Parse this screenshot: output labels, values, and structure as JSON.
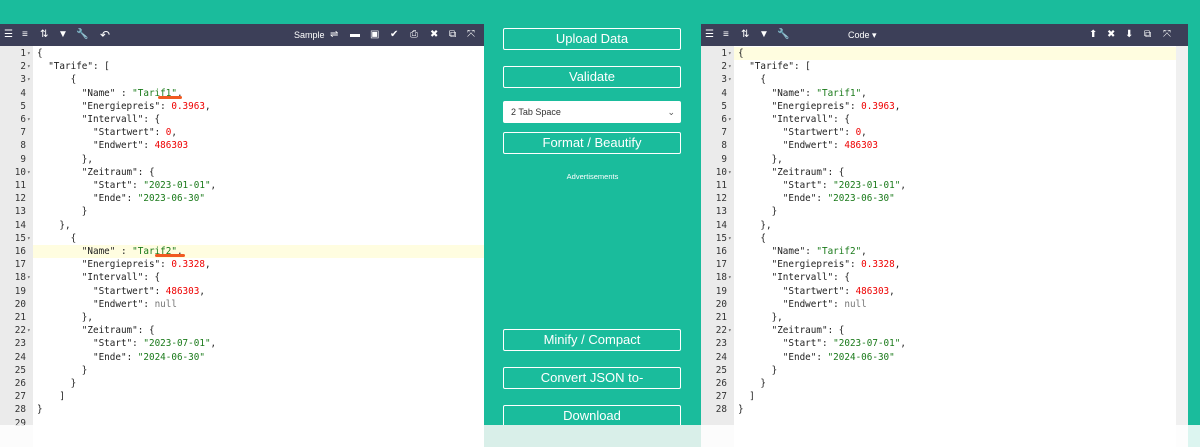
{
  "left_toolbar": {
    "title": "Sample"
  },
  "right_toolbar": {
    "title": "Code ▾"
  },
  "middle": {
    "upload": "Upload Data",
    "validate": "Validate",
    "indent_select": "2 Tab Space",
    "format": "Format / Beautify",
    "ads": "Advertisements",
    "minify": "Minify / Compact",
    "convert": "Convert JSON to-",
    "download": "Download"
  },
  "left_lines": [
    {
      "n": "1",
      "f": "▾",
      "t": [
        [
          "p",
          "{"
        ]
      ]
    },
    {
      "n": "2",
      "f": "▾",
      "t": [
        [
          "p",
          "  "
        ],
        [
          "k",
          "\"Tarife\""
        ],
        [
          "p",
          ": ["
        ]
      ]
    },
    {
      "n": "3",
      "f": "▾",
      "t": [
        [
          "p",
          "      {"
        ]
      ]
    },
    {
      "n": "4",
      "f": "",
      "t": [
        [
          "p",
          "        "
        ],
        [
          "k",
          "\"Name\""
        ],
        [
          "p",
          " : "
        ],
        [
          "s",
          "\"Tarif1\""
        ],
        [
          "p",
          ","
        ]
      ]
    },
    {
      "n": "5",
      "f": "",
      "t": [
        [
          "p",
          "        "
        ],
        [
          "k",
          "\"Energiepreis\""
        ],
        [
          "p",
          ": "
        ],
        [
          "n",
          "0.3963"
        ],
        [
          "p",
          ","
        ]
      ]
    },
    {
      "n": "6",
      "f": "▾",
      "t": [
        [
          "p",
          "        "
        ],
        [
          "k",
          "\"Intervall\""
        ],
        [
          "p",
          ": {"
        ]
      ]
    },
    {
      "n": "7",
      "f": "",
      "t": [
        [
          "p",
          "          "
        ],
        [
          "k",
          "\"Startwert\""
        ],
        [
          "p",
          ": "
        ],
        [
          "n",
          "0"
        ],
        [
          "p",
          ","
        ]
      ]
    },
    {
      "n": "8",
      "f": "",
      "t": [
        [
          "p",
          "          "
        ],
        [
          "k",
          "\"Endwert\""
        ],
        [
          "p",
          ": "
        ],
        [
          "n",
          "486303"
        ]
      ]
    },
    {
      "n": "9",
      "f": "",
      "t": [
        [
          "p",
          "        },"
        ]
      ]
    },
    {
      "n": "10",
      "f": "▾",
      "t": [
        [
          "p",
          "        "
        ],
        [
          "k",
          "\"Zeitraum\""
        ],
        [
          "p",
          ": {"
        ]
      ]
    },
    {
      "n": "11",
      "f": "",
      "t": [
        [
          "p",
          "          "
        ],
        [
          "k",
          "\"Start\""
        ],
        [
          "p",
          ": "
        ],
        [
          "s",
          "\"2023-01-01\""
        ],
        [
          "p",
          ","
        ]
      ]
    },
    {
      "n": "12",
      "f": "",
      "t": [
        [
          "p",
          "          "
        ],
        [
          "k",
          "\"Ende\""
        ],
        [
          "p",
          ": "
        ],
        [
          "s",
          "\"2023-06-30\""
        ]
      ]
    },
    {
      "n": "13",
      "f": "",
      "t": [
        [
          "p",
          "        }"
        ]
      ]
    },
    {
      "n": "14",
      "f": "",
      "t": [
        [
          "p",
          "    },"
        ]
      ]
    },
    {
      "n": "15",
      "f": "▾",
      "t": [
        [
          "p",
          "      {"
        ]
      ]
    },
    {
      "n": "16",
      "f": "",
      "t": [
        [
          "p",
          "        "
        ],
        [
          "k",
          "\"Name\""
        ],
        [
          "p",
          " : "
        ],
        [
          "s",
          "\"Tarif2\""
        ],
        [
          "p",
          ","
        ]
      ]
    },
    {
      "n": "17",
      "f": "",
      "t": [
        [
          "p",
          "        "
        ],
        [
          "k",
          "\"Energiepreis\""
        ],
        [
          "p",
          ": "
        ],
        [
          "n",
          "0.3328"
        ],
        [
          "p",
          ","
        ]
      ]
    },
    {
      "n": "18",
      "f": "▾",
      "t": [
        [
          "p",
          "        "
        ],
        [
          "k",
          "\"Intervall\""
        ],
        [
          "p",
          ": {"
        ]
      ]
    },
    {
      "n": "19",
      "f": "",
      "t": [
        [
          "p",
          "          "
        ],
        [
          "k",
          "\"Startwert\""
        ],
        [
          "p",
          ": "
        ],
        [
          "n",
          "486303"
        ],
        [
          "p",
          ","
        ]
      ]
    },
    {
      "n": "20",
      "f": "",
      "t": [
        [
          "p",
          "          "
        ],
        [
          "k",
          "\"Endwert\""
        ],
        [
          "p",
          ": "
        ],
        [
          "nu",
          "null"
        ]
      ]
    },
    {
      "n": "21",
      "f": "",
      "t": [
        [
          "p",
          "        },"
        ]
      ]
    },
    {
      "n": "22",
      "f": "▾",
      "t": [
        [
          "p",
          "        "
        ],
        [
          "k",
          "\"Zeitraum\""
        ],
        [
          "p",
          ": {"
        ]
      ]
    },
    {
      "n": "23",
      "f": "",
      "t": [
        [
          "p",
          "          "
        ],
        [
          "k",
          "\"Start\""
        ],
        [
          "p",
          ": "
        ],
        [
          "s",
          "\"2023-07-01\""
        ],
        [
          "p",
          ","
        ]
      ]
    },
    {
      "n": "24",
      "f": "",
      "t": [
        [
          "p",
          "          "
        ],
        [
          "k",
          "\"Ende\""
        ],
        [
          "p",
          ": "
        ],
        [
          "s",
          "\"2024-06-30\""
        ]
      ]
    },
    {
      "n": "25",
      "f": "",
      "t": [
        [
          "p",
          "        }"
        ]
      ]
    },
    {
      "n": "26",
      "f": "",
      "t": [
        [
          "p",
          "      }"
        ]
      ]
    },
    {
      "n": "27",
      "f": "",
      "t": [
        [
          "p",
          "    ]"
        ]
      ]
    },
    {
      "n": "28",
      "f": "",
      "t": [
        [
          "p",
          "}"
        ]
      ]
    },
    {
      "n": "29",
      "f": "",
      "t": []
    }
  ],
  "right_lines": [
    {
      "n": "1",
      "f": "▾",
      "t": [
        [
          "p",
          "{"
        ]
      ]
    },
    {
      "n": "2",
      "f": "▾",
      "t": [
        [
          "p",
          "  "
        ],
        [
          "k",
          "\"Tarife\""
        ],
        [
          "p",
          ": ["
        ]
      ]
    },
    {
      "n": "3",
      "f": "▾",
      "t": [
        [
          "p",
          "    {"
        ]
      ]
    },
    {
      "n": "4",
      "f": "",
      "t": [
        [
          "p",
          "      "
        ],
        [
          "k",
          "\"Name\""
        ],
        [
          "p",
          ": "
        ],
        [
          "s",
          "\"Tarif1\""
        ],
        [
          "p",
          ","
        ]
      ]
    },
    {
      "n": "5",
      "f": "",
      "t": [
        [
          "p",
          "      "
        ],
        [
          "k",
          "\"Energiepreis\""
        ],
        [
          "p",
          ": "
        ],
        [
          "n",
          "0.3963"
        ],
        [
          "p",
          ","
        ]
      ]
    },
    {
      "n": "6",
      "f": "▾",
      "t": [
        [
          "p",
          "      "
        ],
        [
          "k",
          "\"Intervall\""
        ],
        [
          "p",
          ": {"
        ]
      ]
    },
    {
      "n": "7",
      "f": "",
      "t": [
        [
          "p",
          "        "
        ],
        [
          "k",
          "\"Startwert\""
        ],
        [
          "p",
          ": "
        ],
        [
          "n",
          "0"
        ],
        [
          "p",
          ","
        ]
      ]
    },
    {
      "n": "8",
      "f": "",
      "t": [
        [
          "p",
          "        "
        ],
        [
          "k",
          "\"Endwert\""
        ],
        [
          "p",
          ": "
        ],
        [
          "n",
          "486303"
        ]
      ]
    },
    {
      "n": "9",
      "f": "",
      "t": [
        [
          "p",
          "      },"
        ]
      ]
    },
    {
      "n": "10",
      "f": "▾",
      "t": [
        [
          "p",
          "      "
        ],
        [
          "k",
          "\"Zeitraum\""
        ],
        [
          "p",
          ": {"
        ]
      ]
    },
    {
      "n": "11",
      "f": "",
      "t": [
        [
          "p",
          "        "
        ],
        [
          "k",
          "\"Start\""
        ],
        [
          "p",
          ": "
        ],
        [
          "s",
          "\"2023-01-01\""
        ],
        [
          "p",
          ","
        ]
      ]
    },
    {
      "n": "12",
      "f": "",
      "t": [
        [
          "p",
          "        "
        ],
        [
          "k",
          "\"Ende\""
        ],
        [
          "p",
          ": "
        ],
        [
          "s",
          "\"2023-06-30\""
        ]
      ]
    },
    {
      "n": "13",
      "f": "",
      "t": [
        [
          "p",
          "      }"
        ]
      ]
    },
    {
      "n": "14",
      "f": "",
      "t": [
        [
          "p",
          "    },"
        ]
      ]
    },
    {
      "n": "15",
      "f": "▾",
      "t": [
        [
          "p",
          "    {"
        ]
      ]
    },
    {
      "n": "16",
      "f": "",
      "t": [
        [
          "p",
          "      "
        ],
        [
          "k",
          "\"Name\""
        ],
        [
          "p",
          ": "
        ],
        [
          "s",
          "\"Tarif2\""
        ],
        [
          "p",
          ","
        ]
      ]
    },
    {
      "n": "17",
      "f": "",
      "t": [
        [
          "p",
          "      "
        ],
        [
          "k",
          "\"Energiepreis\""
        ],
        [
          "p",
          ": "
        ],
        [
          "n",
          "0.3328"
        ],
        [
          "p",
          ","
        ]
      ]
    },
    {
      "n": "18",
      "f": "▾",
      "t": [
        [
          "p",
          "      "
        ],
        [
          "k",
          "\"Intervall\""
        ],
        [
          "p",
          ": {"
        ]
      ]
    },
    {
      "n": "19",
      "f": "",
      "t": [
        [
          "p",
          "        "
        ],
        [
          "k",
          "\"Startwert\""
        ],
        [
          "p",
          ": "
        ],
        [
          "n",
          "486303"
        ],
        [
          "p",
          ","
        ]
      ]
    },
    {
      "n": "20",
      "f": "",
      "t": [
        [
          "p",
          "        "
        ],
        [
          "k",
          "\"Endwert\""
        ],
        [
          "p",
          ": "
        ],
        [
          "nu",
          "null"
        ]
      ]
    },
    {
      "n": "21",
      "f": "",
      "t": [
        [
          "p",
          "      },"
        ]
      ]
    },
    {
      "n": "22",
      "f": "▾",
      "t": [
        [
          "p",
          "      "
        ],
        [
          "k",
          "\"Zeitraum\""
        ],
        [
          "p",
          ": {"
        ]
      ]
    },
    {
      "n": "23",
      "f": "",
      "t": [
        [
          "p",
          "        "
        ],
        [
          "k",
          "\"Start\""
        ],
        [
          "p",
          ": "
        ],
        [
          "s",
          "\"2023-07-01\""
        ],
        [
          "p",
          ","
        ]
      ]
    },
    {
      "n": "24",
      "f": "",
      "t": [
        [
          "p",
          "        "
        ],
        [
          "k",
          "\"Ende\""
        ],
        [
          "p",
          ": "
        ],
        [
          "s",
          "\"2024-06-30\""
        ]
      ]
    },
    {
      "n": "25",
      "f": "",
      "t": [
        [
          "p",
          "      }"
        ]
      ]
    },
    {
      "n": "26",
      "f": "",
      "t": [
        [
          "p",
          "    }"
        ]
      ]
    },
    {
      "n": "27",
      "f": "",
      "t": [
        [
          "p",
          "  ]"
        ]
      ]
    },
    {
      "n": "28",
      "f": "",
      "t": [
        [
          "p",
          "}"
        ]
      ]
    }
  ]
}
